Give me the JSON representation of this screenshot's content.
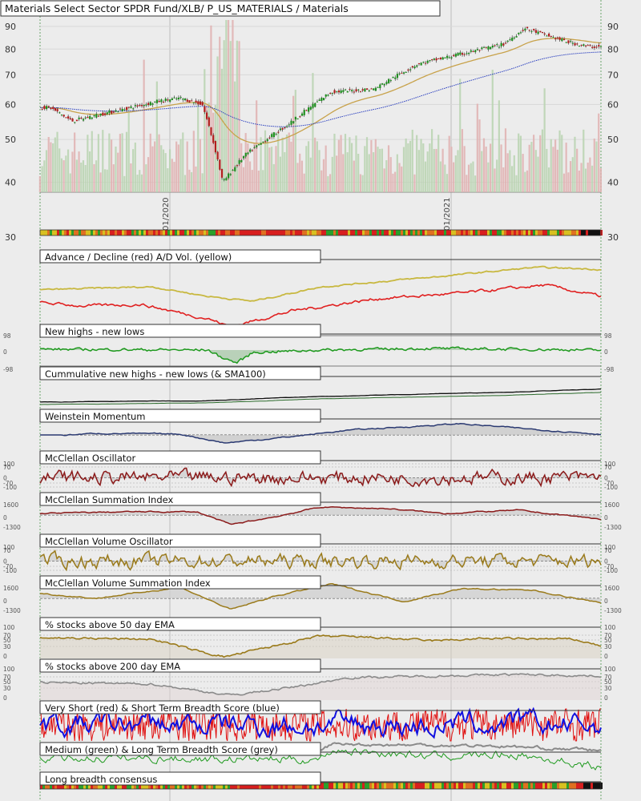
{
  "title": "Materials Select Sector SPDR Fund/XLB/ P_US_MATERIALS / Materials",
  "colors": {
    "background": "#ececec",
    "up_candle": "#1f8f1f",
    "down_candle": "#b21d1d",
    "ema_short": "#c8a24a",
    "ema_long": "#2a3fbf",
    "ad_line": "#e02020",
    "ad_volume": "#c8b840",
    "momentum": "#2b3a72",
    "mcclellan": "#8b1a1a",
    "volume_osc": "#9a7a1a",
    "grey_line": "#8a8a8a",
    "green_line": "#1f9a1f",
    "blue_line": "#1010e0",
    "red_line": "#e01010"
  },
  "chart_data": [
    {
      "type": "candlestick",
      "name": "price",
      "title": "Materials Select Sector SPDR Fund/XLB/ P_US_MATERIALS / Materials",
      "scale": "log",
      "ylim": [
        38,
        95
      ],
      "yticks": [
        40,
        50,
        60,
        70,
        80,
        90
      ],
      "xticks": [
        "01/2020",
        "01/2021"
      ],
      "extra_label": "30",
      "series": [
        {
          "name": "price",
          "values": [
            {
              "x": "2019-07",
              "y": 59
            },
            {
              "x": "2019-08",
              "y": 55
            },
            {
              "x": "2019-10",
              "y": 58
            },
            {
              "x": "2019-12",
              "y": 61
            },
            {
              "x": "2020-01",
              "y": 62
            },
            {
              "x": "2020-02",
              "y": 60
            },
            {
              "x": "2020-03",
              "y": 40
            },
            {
              "x": "2020-04",
              "y": 46
            },
            {
              "x": "2020-06",
              "y": 54
            },
            {
              "x": "2020-08",
              "y": 64
            },
            {
              "x": "2020-10",
              "y": 65
            },
            {
              "x": "2020-12",
              "y": 74
            },
            {
              "x": "2021-02",
              "y": 78
            },
            {
              "x": "2021-04",
              "y": 82
            },
            {
              "x": "2021-05",
              "y": 89
            },
            {
              "x": "2021-07",
              "y": 83
            },
            {
              "x": "2021-08",
              "y": 81
            }
          ]
        }
      ]
    },
    {
      "type": "line",
      "title": "Advance / Decline (red) A/D Vol. (yellow)"
    },
    {
      "type": "line",
      "title": "New highs - new lows",
      "yticks": [
        "98",
        "0",
        "-98"
      ]
    },
    {
      "type": "line",
      "title": "Cummulative new highs - new lows (& SMA100)"
    },
    {
      "type": "area",
      "title": "Weinstein Momentum"
    },
    {
      "type": "area",
      "title": "McClellan Oscillator",
      "yticks": [
        "100",
        "70",
        "0",
        "-70",
        "-100"
      ]
    },
    {
      "type": "area",
      "title": "McClellan Summation Index",
      "yticks": [
        "1600",
        "0",
        "-1300"
      ]
    },
    {
      "type": "area",
      "title": "McClellan Volume Oscillator",
      "yticks": [
        "100",
        "70",
        "0",
        "-70",
        "-100"
      ]
    },
    {
      "type": "area",
      "title": "McClellan Volume Summation Index",
      "yticks": [
        "1600",
        "0",
        "-1300"
      ]
    },
    {
      "type": "line",
      "title": "% stocks above 50 day EMA",
      "yticks": [
        "100",
        "70",
        "50",
        "30",
        "0"
      ]
    },
    {
      "type": "line",
      "title": "% stocks above 200 day EMA",
      "yticks": [
        "100",
        "70",
        "50",
        "30",
        "0"
      ]
    },
    {
      "type": "line",
      "title": "Very Short (red) & Short Term Breadth Score (blue)"
    },
    {
      "type": "line",
      "title": "Medium (green) & Long Term Breadth Score (grey)"
    },
    {
      "type": "heatmap",
      "title": "Long breadth consensus"
    }
  ]
}
